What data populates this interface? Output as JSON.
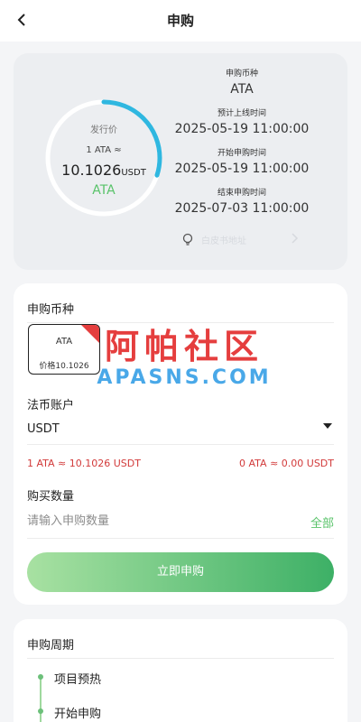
{
  "header": {
    "title": "申购"
  },
  "info": {
    "ring_label": "发行价",
    "ring_rate": "1 ATA ≈",
    "ring_price": "10.1026",
    "ring_unit": "USDT",
    "ring_coin": "ATA",
    "ring_progress": 0.3,
    "items": [
      {
        "label": "申购币种",
        "value": "ATA"
      },
      {
        "label": "预计上线时间",
        "value": "2025-05-19 11:00:00"
      },
      {
        "label": "开始申购时间",
        "value": "2025-05-19 11:00:00"
      },
      {
        "label": "结束申购时间",
        "value": "2025-07-03 11:00:00"
      }
    ],
    "whitepaper_label": "白皮书地址"
  },
  "form": {
    "coin_section_label": "申购币种",
    "coin_chip_name": "ATA",
    "coin_chip_price": "价格10.1026",
    "fiat_section_label": "法币账户",
    "fiat_value": "USDT",
    "rate_left": "1 ATA ≈ 10.1026 USDT",
    "rate_right": "0 ATA ≈ 0.00 USDT",
    "qty_section_label": "购买数量",
    "qty_placeholder": "请输入申购数量",
    "all_label": "全部",
    "submit_label": "立即申购"
  },
  "watermark": {
    "cn": "阿帕社区",
    "en": "APASNS.COM"
  },
  "period": {
    "label": "申购周期",
    "steps": [
      "项目预热",
      "开始申购"
    ]
  },
  "colors": {
    "accent_green": "#59c36a",
    "ring_blue": "#2fb7e0",
    "rate_red": "#d23a3a"
  }
}
